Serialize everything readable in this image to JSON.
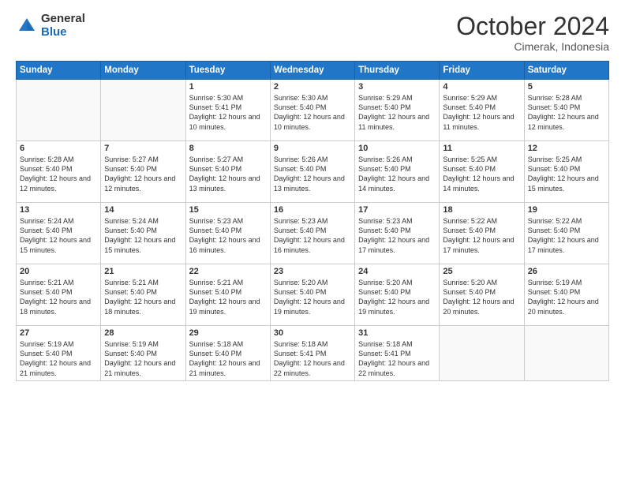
{
  "logo": {
    "general": "General",
    "blue": "Blue"
  },
  "header": {
    "title": "October 2024",
    "subtitle": "Cimerak, Indonesia"
  },
  "weekdays": [
    "Sunday",
    "Monday",
    "Tuesday",
    "Wednesday",
    "Thursday",
    "Friday",
    "Saturday"
  ],
  "weeks": [
    [
      {
        "day": "",
        "sunrise": "",
        "sunset": "",
        "daylight": ""
      },
      {
        "day": "",
        "sunrise": "",
        "sunset": "",
        "daylight": ""
      },
      {
        "day": "1",
        "sunrise": "Sunrise: 5:30 AM",
        "sunset": "Sunset: 5:41 PM",
        "daylight": "Daylight: 12 hours and 10 minutes."
      },
      {
        "day": "2",
        "sunrise": "Sunrise: 5:30 AM",
        "sunset": "Sunset: 5:40 PM",
        "daylight": "Daylight: 12 hours and 10 minutes."
      },
      {
        "day": "3",
        "sunrise": "Sunrise: 5:29 AM",
        "sunset": "Sunset: 5:40 PM",
        "daylight": "Daylight: 12 hours and 11 minutes."
      },
      {
        "day": "4",
        "sunrise": "Sunrise: 5:29 AM",
        "sunset": "Sunset: 5:40 PM",
        "daylight": "Daylight: 12 hours and 11 minutes."
      },
      {
        "day": "5",
        "sunrise": "Sunrise: 5:28 AM",
        "sunset": "Sunset: 5:40 PM",
        "daylight": "Daylight: 12 hours and 12 minutes."
      }
    ],
    [
      {
        "day": "6",
        "sunrise": "Sunrise: 5:28 AM",
        "sunset": "Sunset: 5:40 PM",
        "daylight": "Daylight: 12 hours and 12 minutes."
      },
      {
        "day": "7",
        "sunrise": "Sunrise: 5:27 AM",
        "sunset": "Sunset: 5:40 PM",
        "daylight": "Daylight: 12 hours and 12 minutes."
      },
      {
        "day": "8",
        "sunrise": "Sunrise: 5:27 AM",
        "sunset": "Sunset: 5:40 PM",
        "daylight": "Daylight: 12 hours and 13 minutes."
      },
      {
        "day": "9",
        "sunrise": "Sunrise: 5:26 AM",
        "sunset": "Sunset: 5:40 PM",
        "daylight": "Daylight: 12 hours and 13 minutes."
      },
      {
        "day": "10",
        "sunrise": "Sunrise: 5:26 AM",
        "sunset": "Sunset: 5:40 PM",
        "daylight": "Daylight: 12 hours and 14 minutes."
      },
      {
        "day": "11",
        "sunrise": "Sunrise: 5:25 AM",
        "sunset": "Sunset: 5:40 PM",
        "daylight": "Daylight: 12 hours and 14 minutes."
      },
      {
        "day": "12",
        "sunrise": "Sunrise: 5:25 AM",
        "sunset": "Sunset: 5:40 PM",
        "daylight": "Daylight: 12 hours and 15 minutes."
      }
    ],
    [
      {
        "day": "13",
        "sunrise": "Sunrise: 5:24 AM",
        "sunset": "Sunset: 5:40 PM",
        "daylight": "Daylight: 12 hours and 15 minutes."
      },
      {
        "day": "14",
        "sunrise": "Sunrise: 5:24 AM",
        "sunset": "Sunset: 5:40 PM",
        "daylight": "Daylight: 12 hours and 15 minutes."
      },
      {
        "day": "15",
        "sunrise": "Sunrise: 5:23 AM",
        "sunset": "Sunset: 5:40 PM",
        "daylight": "Daylight: 12 hours and 16 minutes."
      },
      {
        "day": "16",
        "sunrise": "Sunrise: 5:23 AM",
        "sunset": "Sunset: 5:40 PM",
        "daylight": "Daylight: 12 hours and 16 minutes."
      },
      {
        "day": "17",
        "sunrise": "Sunrise: 5:23 AM",
        "sunset": "Sunset: 5:40 PM",
        "daylight": "Daylight: 12 hours and 17 minutes."
      },
      {
        "day": "18",
        "sunrise": "Sunrise: 5:22 AM",
        "sunset": "Sunset: 5:40 PM",
        "daylight": "Daylight: 12 hours and 17 minutes."
      },
      {
        "day": "19",
        "sunrise": "Sunrise: 5:22 AM",
        "sunset": "Sunset: 5:40 PM",
        "daylight": "Daylight: 12 hours and 17 minutes."
      }
    ],
    [
      {
        "day": "20",
        "sunrise": "Sunrise: 5:21 AM",
        "sunset": "Sunset: 5:40 PM",
        "daylight": "Daylight: 12 hours and 18 minutes."
      },
      {
        "day": "21",
        "sunrise": "Sunrise: 5:21 AM",
        "sunset": "Sunset: 5:40 PM",
        "daylight": "Daylight: 12 hours and 18 minutes."
      },
      {
        "day": "22",
        "sunrise": "Sunrise: 5:21 AM",
        "sunset": "Sunset: 5:40 PM",
        "daylight": "Daylight: 12 hours and 19 minutes."
      },
      {
        "day": "23",
        "sunrise": "Sunrise: 5:20 AM",
        "sunset": "Sunset: 5:40 PM",
        "daylight": "Daylight: 12 hours and 19 minutes."
      },
      {
        "day": "24",
        "sunrise": "Sunrise: 5:20 AM",
        "sunset": "Sunset: 5:40 PM",
        "daylight": "Daylight: 12 hours and 19 minutes."
      },
      {
        "day": "25",
        "sunrise": "Sunrise: 5:20 AM",
        "sunset": "Sunset: 5:40 PM",
        "daylight": "Daylight: 12 hours and 20 minutes."
      },
      {
        "day": "26",
        "sunrise": "Sunrise: 5:19 AM",
        "sunset": "Sunset: 5:40 PM",
        "daylight": "Daylight: 12 hours and 20 minutes."
      }
    ],
    [
      {
        "day": "27",
        "sunrise": "Sunrise: 5:19 AM",
        "sunset": "Sunset: 5:40 PM",
        "daylight": "Daylight: 12 hours and 21 minutes."
      },
      {
        "day": "28",
        "sunrise": "Sunrise: 5:19 AM",
        "sunset": "Sunset: 5:40 PM",
        "daylight": "Daylight: 12 hours and 21 minutes."
      },
      {
        "day": "29",
        "sunrise": "Sunrise: 5:18 AM",
        "sunset": "Sunset: 5:40 PM",
        "daylight": "Daylight: 12 hours and 21 minutes."
      },
      {
        "day": "30",
        "sunrise": "Sunrise: 5:18 AM",
        "sunset": "Sunset: 5:41 PM",
        "daylight": "Daylight: 12 hours and 22 minutes."
      },
      {
        "day": "31",
        "sunrise": "Sunrise: 5:18 AM",
        "sunset": "Sunset: 5:41 PM",
        "daylight": "Daylight: 12 hours and 22 minutes."
      },
      {
        "day": "",
        "sunrise": "",
        "sunset": "",
        "daylight": ""
      },
      {
        "day": "",
        "sunrise": "",
        "sunset": "",
        "daylight": ""
      }
    ]
  ]
}
